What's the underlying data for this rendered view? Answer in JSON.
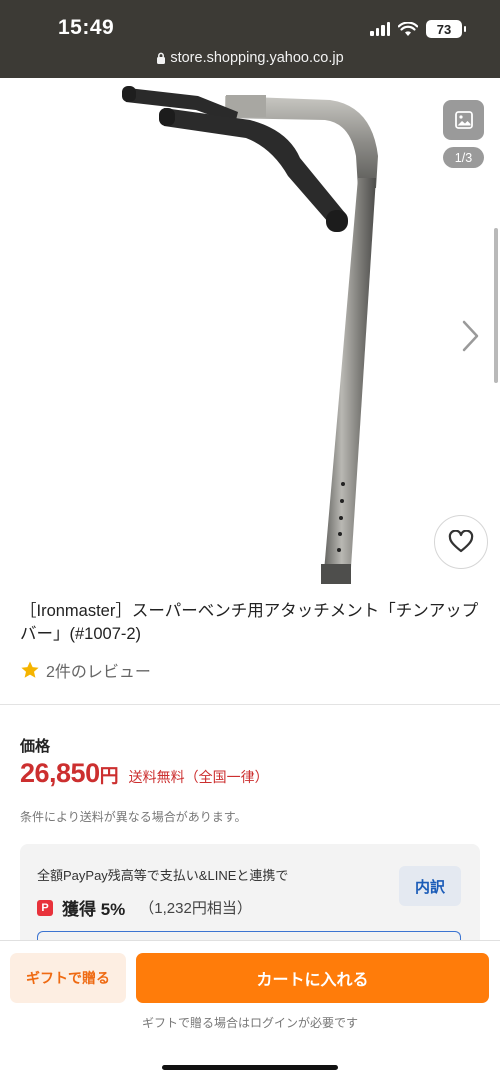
{
  "status_bar": {
    "time": "15:49",
    "battery": "73"
  },
  "browser": {
    "url": "store.shopping.yahoo.co.jp"
  },
  "gallery": {
    "image_counter": "1/3"
  },
  "product": {
    "title": "［Ironmaster］スーパーベンチ用アタッチメント「チンアップバー」(#1007-2)",
    "review_text": "2件のレビュー",
    "price_label": "価格",
    "price": "26,850",
    "price_unit": "円",
    "shipping": "送料無料（全国一律）",
    "shipping_note": "条件により送料が異なる場合があります。"
  },
  "paypay": {
    "line1": "全額PayPay残高等で支払い&LINEと連携で",
    "logo_text": "P",
    "rate": "獲得 5%",
    "equivalent": "（1,232円相当）",
    "breakdown_label": "内訳"
  },
  "bottom": {
    "gift_label": "ギフトで贈る",
    "cart_label": "カートに入れる",
    "login_note": "ギフトで贈る場合はログインが必要です"
  },
  "colors": {
    "price_red": "#cc2f2f",
    "cart_orange": "#ff7c0a",
    "gift_bg": "#fdeee2",
    "star": "#f5b400",
    "link_blue": "#1b5cb8"
  },
  "icons": [
    "lock-icon",
    "signal-icon",
    "wifi-icon",
    "image-icon",
    "chevron-right-icon",
    "heart-icon",
    "star-icon"
  ]
}
